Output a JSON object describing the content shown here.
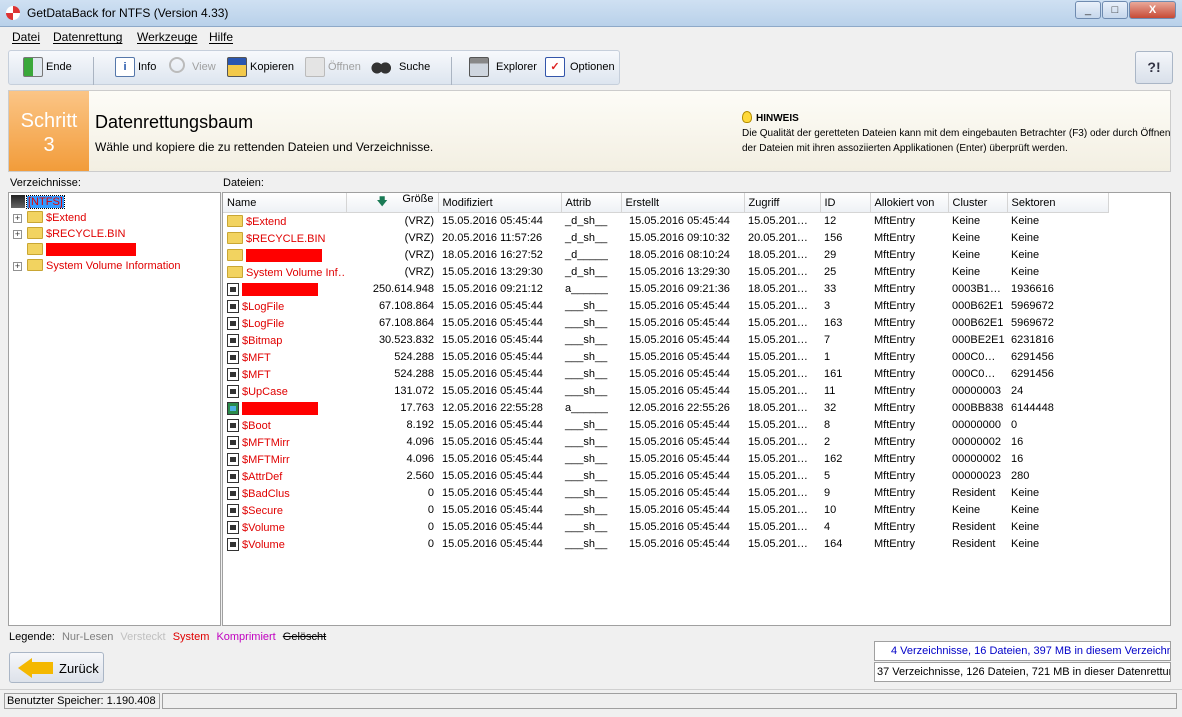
{
  "window": {
    "title": "GetDataBack for NTFS (Version 4.33)",
    "minimize": "_",
    "maximize": "□",
    "close": "X"
  },
  "menu": [
    "Datei",
    "Datenrettung",
    "Werkzeuge",
    "Hilfe"
  ],
  "toolbar": {
    "ende": "Ende",
    "info": "Info",
    "view": "View",
    "kopieren": "Kopieren",
    "oeffnen": "Öffnen",
    "suche": "Suche",
    "explorer": "Explorer",
    "optionen": "Optionen",
    "help": "?!"
  },
  "step": {
    "label": "Schritt",
    "number": "3",
    "title": "Datenrettungsbaum",
    "description": "Wähle und kopiere die zu rettenden Dateien und Verzeichnisse.",
    "hint_title": "HINWEIS",
    "hint_text": "Die Qualität der geretteten Dateien kann mit dem eingebauten Betrachter (F3) oder durch Öffnen der Dateien mit ihren assoziierten Applikationen (Enter) überprüft werden."
  },
  "tree": {
    "label": "Verzeichnisse:",
    "root": "[NTFS]",
    "items": [
      "$Extend",
      "$RECYCLE.BIN",
      "",
      "System Volume Information"
    ]
  },
  "files": {
    "label": "Dateien:",
    "columns": [
      "Name",
      "Größe",
      "Modifiziert",
      "Attrib",
      "Erstellt",
      "Zugriff",
      "ID",
      "Allokiert von",
      "Cluster",
      "Sektoren"
    ],
    "rows": [
      {
        "name": "$Extend",
        "size": "(VRZ)",
        "mod": "15.05.2016 05:45:44",
        "attr": "_d_sh__",
        "created": "15.05.2016 05:45:44",
        "access": "15.05.201…",
        "id": "12",
        "alloc": "MftEntry",
        "cluster": "Keine",
        "sectors": "Keine",
        "icon": "folder",
        "redacted": false
      },
      {
        "name": "$RECYCLE.BIN",
        "size": "(VRZ)",
        "mod": "20.05.2016 11:57:26",
        "attr": "_d_sh__",
        "created": "15.05.2016 09:10:32",
        "access": "20.05.201…",
        "id": "156",
        "alloc": "MftEntry",
        "cluster": "Keine",
        "sectors": "Keine",
        "icon": "folder",
        "redacted": false
      },
      {
        "name": "",
        "size": "(VRZ)",
        "mod": "18.05.2016 16:27:52",
        "attr": "_d_____",
        "created": "18.05.2016 08:10:24",
        "access": "18.05.201…",
        "id": "29",
        "alloc": "MftEntry",
        "cluster": "Keine",
        "sectors": "Keine",
        "icon": "folder",
        "redacted": true
      },
      {
        "name": "System Volume Inf…",
        "size": "(VRZ)",
        "mod": "15.05.2016 13:29:30",
        "attr": "_d_sh__",
        "created": "15.05.2016 13:29:30",
        "access": "15.05.201…",
        "id": "25",
        "alloc": "MftEntry",
        "cluster": "Keine",
        "sectors": "Keine",
        "icon": "folder",
        "redacted": false
      },
      {
        "name": "",
        "size": "250.614.948",
        "mod": "15.05.2016 09:21:12",
        "attr": "a______",
        "created": "15.05.2016 09:21:36",
        "access": "18.05.201…",
        "id": "33",
        "alloc": "MftEntry",
        "cluster": "0003B1…",
        "sectors": "1936616",
        "icon": "file",
        "redacted": true
      },
      {
        "name": "$LogFile",
        "size": "67.108.864",
        "mod": "15.05.2016 05:45:44",
        "attr": "___sh__",
        "created": "15.05.2016 05:45:44",
        "access": "15.05.201…",
        "id": "3",
        "alloc": "MftEntry",
        "cluster": "000B62E1",
        "sectors": "5969672",
        "icon": "file",
        "redacted": false
      },
      {
        "name": "$LogFile",
        "size": "67.108.864",
        "mod": "15.05.2016 05:45:44",
        "attr": "___sh__",
        "created": "15.05.2016 05:45:44",
        "access": "15.05.201…",
        "id": "163",
        "alloc": "MftEntry",
        "cluster": "000B62E1",
        "sectors": "5969672",
        "icon": "file",
        "redacted": false
      },
      {
        "name": "$Bitmap",
        "size": "30.523.832",
        "mod": "15.05.2016 05:45:44",
        "attr": "___sh__",
        "created": "15.05.2016 05:45:44",
        "access": "15.05.201…",
        "id": "7",
        "alloc": "MftEntry",
        "cluster": "000BE2E1",
        "sectors": "6231816",
        "icon": "file",
        "redacted": false
      },
      {
        "name": "$MFT",
        "size": "524.288",
        "mod": "15.05.2016 05:45:44",
        "attr": "___sh__",
        "created": "15.05.2016 05:45:44",
        "access": "15.05.201…",
        "id": "1",
        "alloc": "MftEntry",
        "cluster": "000C0…",
        "sectors": "6291456",
        "icon": "file",
        "redacted": false
      },
      {
        "name": "$MFT",
        "size": "524.288",
        "mod": "15.05.2016 05:45:44",
        "attr": "___sh__",
        "created": "15.05.2016 05:45:44",
        "access": "15.05.201…",
        "id": "161",
        "alloc": "MftEntry",
        "cluster": "000C0…",
        "sectors": "6291456",
        "icon": "file",
        "redacted": false
      },
      {
        "name": "$UpCase",
        "size": "131.072",
        "mod": "15.05.2016 05:45:44",
        "attr": "___sh__",
        "created": "15.05.2016 05:45:44",
        "access": "15.05.201…",
        "id": "11",
        "alloc": "MftEntry",
        "cluster": "00000003",
        "sectors": "24",
        "icon": "file",
        "redacted": false
      },
      {
        "name": "",
        "size": "17.763",
        "mod": "12.05.2016 22:55:28",
        "attr": "a______",
        "created": "12.05.2016 22:55:26",
        "access": "18.05.201…",
        "id": "32",
        "alloc": "MftEntry",
        "cluster": "000BB838",
        "sectors": "6144448",
        "icon": "img",
        "redacted": true
      },
      {
        "name": "$Boot",
        "size": "8.192",
        "mod": "15.05.2016 05:45:44",
        "attr": "___sh__",
        "created": "15.05.2016 05:45:44",
        "access": "15.05.201…",
        "id": "8",
        "alloc": "MftEntry",
        "cluster": "00000000",
        "sectors": "0",
        "icon": "file",
        "redacted": false
      },
      {
        "name": "$MFTMirr",
        "size": "4.096",
        "mod": "15.05.2016 05:45:44",
        "attr": "___sh__",
        "created": "15.05.2016 05:45:44",
        "access": "15.05.201…",
        "id": "2",
        "alloc": "MftEntry",
        "cluster": "00000002",
        "sectors": "16",
        "icon": "file",
        "redacted": false
      },
      {
        "name": "$MFTMirr",
        "size": "4.096",
        "mod": "15.05.2016 05:45:44",
        "attr": "___sh__",
        "created": "15.05.2016 05:45:44",
        "access": "15.05.201…",
        "id": "162",
        "alloc": "MftEntry",
        "cluster": "00000002",
        "sectors": "16",
        "icon": "file",
        "redacted": false
      },
      {
        "name": "$AttrDef",
        "size": "2.560",
        "mod": "15.05.2016 05:45:44",
        "attr": "___sh__",
        "created": "15.05.2016 05:45:44",
        "access": "15.05.201…",
        "id": "5",
        "alloc": "MftEntry",
        "cluster": "00000023",
        "sectors": "280",
        "icon": "file",
        "redacted": false
      },
      {
        "name": "$BadClus",
        "size": "0",
        "mod": "15.05.2016 05:45:44",
        "attr": "___sh__",
        "created": "15.05.2016 05:45:44",
        "access": "15.05.201…",
        "id": "9",
        "alloc": "MftEntry",
        "cluster": "Resident",
        "sectors": "Keine",
        "icon": "file",
        "redacted": false
      },
      {
        "name": "$Secure",
        "size": "0",
        "mod": "15.05.2016 05:45:44",
        "attr": "___sh__",
        "created": "15.05.2016 05:45:44",
        "access": "15.05.201…",
        "id": "10",
        "alloc": "MftEntry",
        "cluster": "Keine",
        "sectors": "Keine",
        "icon": "file",
        "redacted": false
      },
      {
        "name": "$Volume",
        "size": "0",
        "mod": "15.05.2016 05:45:44",
        "attr": "___sh__",
        "created": "15.05.2016 05:45:44",
        "access": "15.05.201…",
        "id": "4",
        "alloc": "MftEntry",
        "cluster": "Resident",
        "sectors": "Keine",
        "icon": "file",
        "redacted": false
      },
      {
        "name": "$Volume",
        "size": "0",
        "mod": "15.05.2016 05:45:44",
        "attr": "___sh__",
        "created": "15.05.2016 05:45:44",
        "access": "15.05.201…",
        "id": "164",
        "alloc": "MftEntry",
        "cluster": "Resident",
        "sectors": "Keine",
        "icon": "file",
        "redacted": false
      }
    ]
  },
  "legend": {
    "label": "Legende:",
    "readonly": "Nur-Lesen",
    "hidden": "Versteckt",
    "system": "System",
    "compressed": "Komprimiert",
    "deleted": "Gelöscht"
  },
  "colors": {
    "system": "#e00000",
    "readonly": "#808080",
    "hidden": "#c0c0c0",
    "compressed": "#c000c0",
    "selected": "#3399ff"
  },
  "back_button": "Zurück",
  "summary": {
    "current": "4 Verzeichnisse, 16 Dateien, 397 MB in diesem Verzeichnis",
    "total": "37 Verzeichnisse, 126 Dateien, 721 MB in dieser Datenrettung"
  },
  "statusbar": {
    "memory": "Benutzter Speicher: 1.190.408"
  }
}
